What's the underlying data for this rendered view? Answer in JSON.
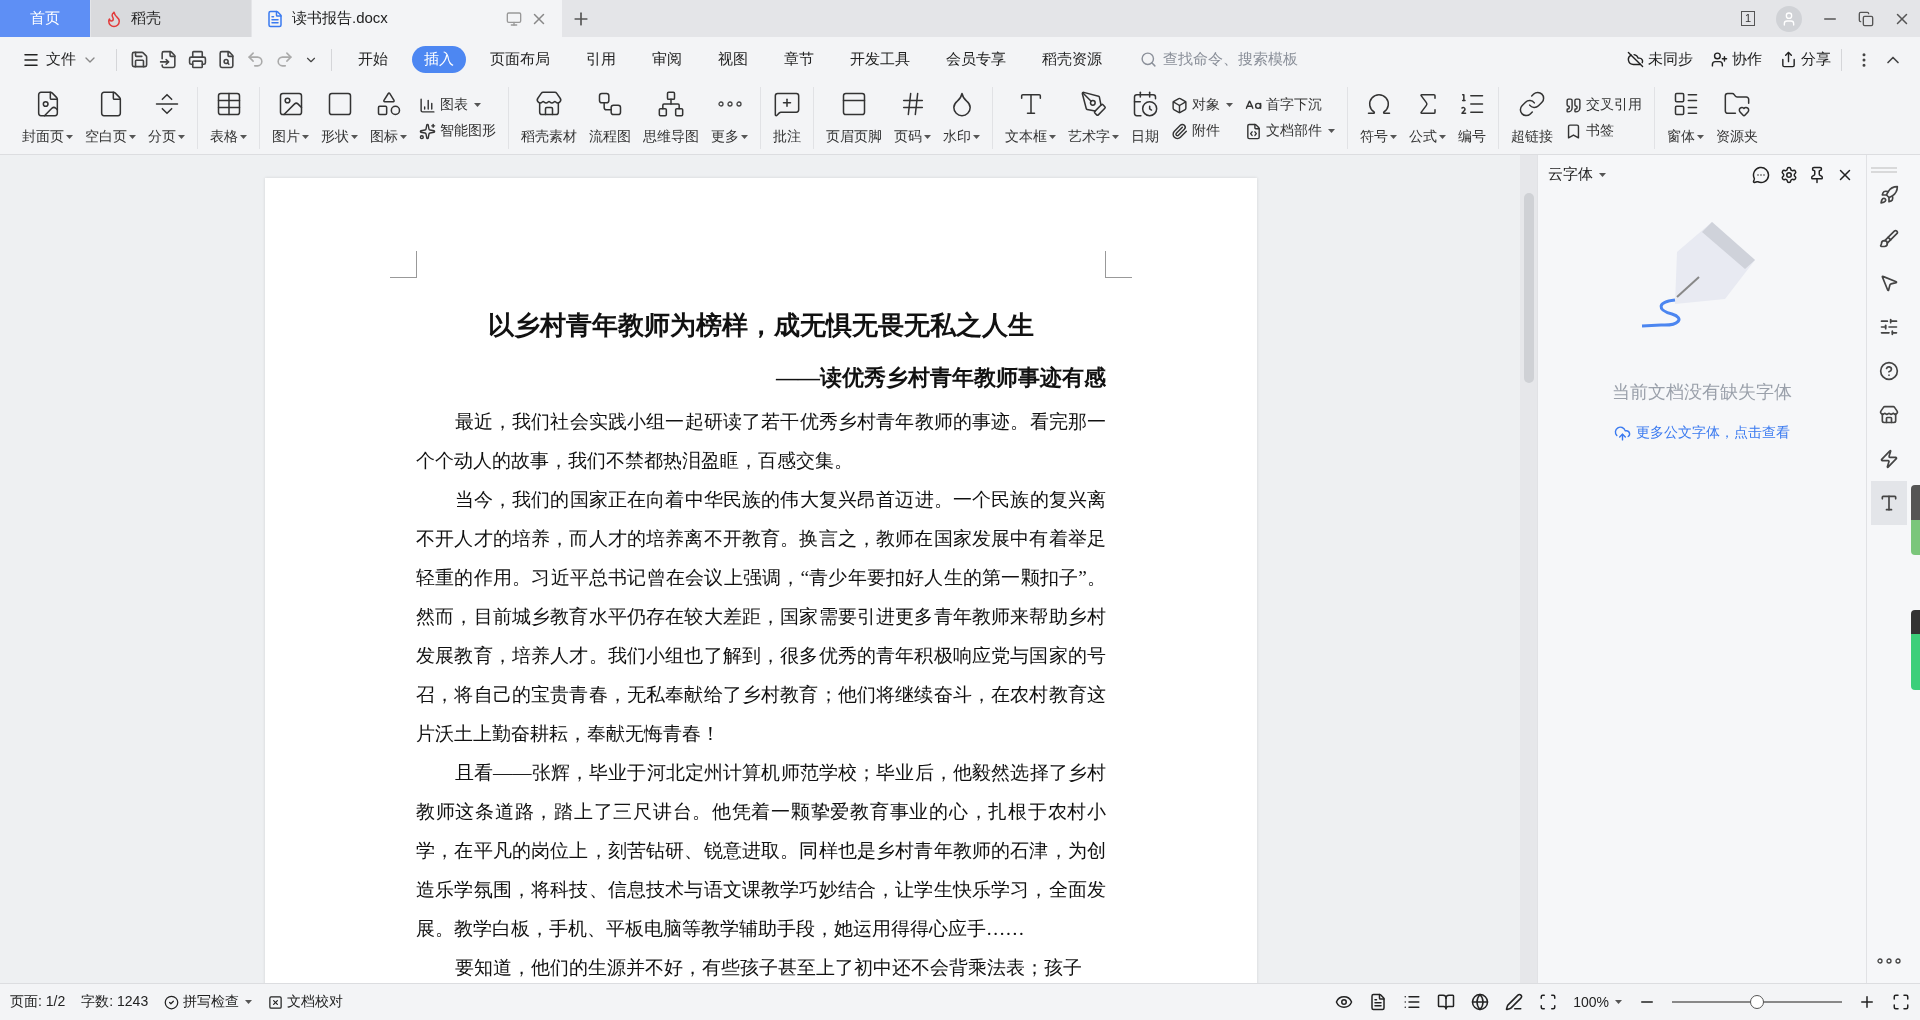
{
  "tabs": [
    {
      "label": "首页",
      "kind": "home",
      "selected": false
    },
    {
      "label": "稻壳",
      "kind": "app",
      "selected": false
    },
    {
      "label": "读书报告.docx",
      "kind": "doc",
      "selected": true
    }
  ],
  "window_count": "1",
  "menu": {
    "file": "文件",
    "tabs": [
      {
        "label": "开始",
        "selected": false
      },
      {
        "label": "插入",
        "selected": true
      },
      {
        "label": "页面布局",
        "selected": false
      },
      {
        "label": "引用",
        "selected": false
      },
      {
        "label": "审阅",
        "selected": false
      },
      {
        "label": "视图",
        "selected": false
      },
      {
        "label": "章节",
        "selected": false
      },
      {
        "label": "开发工具",
        "selected": false
      },
      {
        "label": "会员专享",
        "selected": false
      },
      {
        "label": "稻壳资源",
        "selected": false
      }
    ],
    "search": {
      "placeholder": "查找命令、搜索模板"
    },
    "actions": [
      "未同步",
      "协作",
      "分享"
    ]
  },
  "ribbon": {
    "groups": [
      [
        {
          "kind": "big",
          "label": "封面页",
          "caret": true
        },
        {
          "kind": "big",
          "label": "空白页",
          "caret": true
        },
        {
          "kind": "big",
          "label": "分页",
          "caret": true
        }
      ],
      [
        {
          "kind": "big",
          "label": "表格",
          "caret": true
        }
      ],
      [
        {
          "kind": "big",
          "label": "图片",
          "caret": true
        },
        {
          "kind": "big",
          "label": "形状",
          "caret": true
        },
        {
          "kind": "big",
          "label": "图标",
          "caret": true
        },
        {
          "kind": "stack",
          "items": [
            {
              "label": "图表",
              "caret": true
            },
            {
              "label": "智能图形",
              "caret": false
            }
          ]
        }
      ],
      [
        {
          "kind": "big",
          "label": "稻壳素材",
          "caret": false
        },
        {
          "kind": "big",
          "label": "流程图",
          "caret": false
        },
        {
          "kind": "big",
          "label": "思维导图",
          "caret": false
        },
        {
          "kind": "big",
          "label": "更多",
          "caret": true
        }
      ],
      [
        {
          "kind": "big",
          "label": "批注",
          "caret": false
        }
      ],
      [
        {
          "kind": "big",
          "label": "页眉页脚",
          "caret": false
        },
        {
          "kind": "big",
          "label": "页码",
          "caret": true
        },
        {
          "kind": "big",
          "label": "水印",
          "caret": true
        }
      ],
      [
        {
          "kind": "big",
          "label": "文本框",
          "caret": true
        },
        {
          "kind": "big",
          "label": "艺术字",
          "caret": true
        },
        {
          "kind": "big",
          "label": "日期",
          "caret": false
        },
        {
          "kind": "stack",
          "items": [
            {
              "label": "对象",
              "caret": true
            },
            {
              "label": "附件",
              "caret": false
            }
          ]
        },
        {
          "kind": "stack",
          "items": [
            {
              "label": "首字下沉",
              "caret": false
            },
            {
              "label": "文档部件",
              "caret": true
            }
          ]
        }
      ],
      [
        {
          "kind": "big",
          "label": "符号",
          "caret": true
        },
        {
          "kind": "big",
          "label": "公式",
          "caret": true
        },
        {
          "kind": "big",
          "label": "编号",
          "caret": false
        }
      ],
      [
        {
          "kind": "big",
          "label": "超链接",
          "caret": false
        },
        {
          "kind": "stack",
          "items": [
            {
              "label": "交叉引用",
              "caret": false
            },
            {
              "label": "书签",
              "caret": false
            }
          ]
        }
      ],
      [
        {
          "kind": "big",
          "label": "窗体",
          "caret": true
        },
        {
          "kind": "big",
          "label": "资源夹",
          "caret": false
        }
      ]
    ]
  },
  "document": {
    "title": "以乡村青年教师为榜样，成无惧无畏无私之人生",
    "subtitle": "——读优秀乡村青年教师事迹有感",
    "paragraphs": [
      "最近，我们社会实践小组一起研读了若干优秀乡村青年教师的事迹。看完那一个个动人的故事，我们不禁都热泪盈眶，百感交集。",
      "当今，我们的国家正在向着中华民族的伟大复兴昂首迈进。一个民族的复兴离不开人才的培养，而人才的培养离不开教育。换言之，教师在国家发展中有着举足轻重的作用。习近平总书记曾在会议上强调，“青少年要扣好人生的第一颗扣子”。然而，目前城乡教育水平仍存在较大差距，国家需要引进更多青年教师来帮助乡村发展教育，培养人才。我们小组也了解到，很多优秀的青年积极响应党与国家的号召，将自己的宝贵青春，无私奉献给了乡村教育；他们将继续奋斗，在农村教育这片沃土上勤奋耕耘，奉献无悔青春！",
      "且看——张辉，毕业于河北定州计算机师范学校；毕业后，他毅然选择了乡村教师这条道路，踏上了三尺讲台。他凭着一颗挚爱教育事业的心，扎根于农村小学，在平凡的岗位上，刻苦钻研、锐意进取。同样也是乡村青年教师的石津，为创造乐学氛围，将科技、信息技术与语文课教学巧妙结合，让学生快乐学习，全面发展。教学白板，手机、平板电脑等教学辅助手段，她运用得得心应手……",
      "要知道，他们的生源并不好，有些孩子甚至上了初中还不会背乘法表；孩子"
    ]
  },
  "font_panel": {
    "title": "云字体",
    "message": "当前文档没有缺失字体",
    "link": "更多公文字体，点击查看"
  },
  "status_bar": {
    "page": "页面: 1/2",
    "words": "字数: 1243",
    "spell_check": "拼写检查",
    "proofread": "文档校对",
    "zoom": "100%",
    "zoom_slider": {
      "level": 0.5
    }
  }
}
